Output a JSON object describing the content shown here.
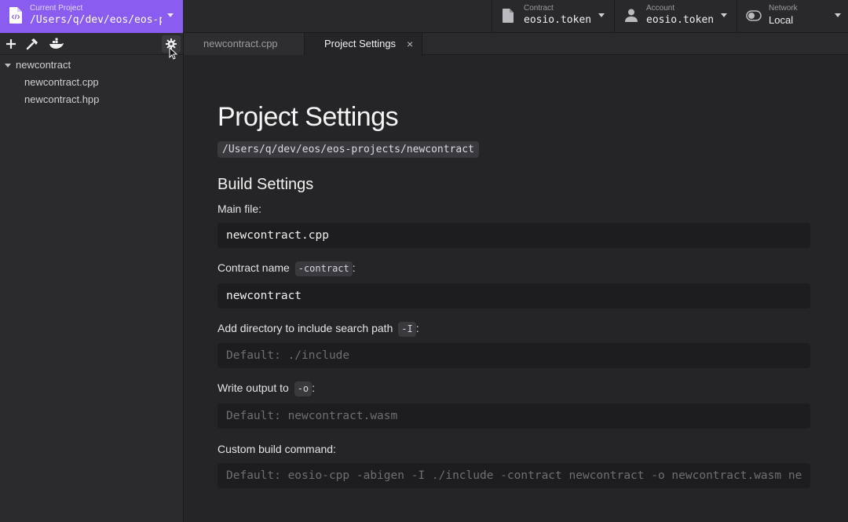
{
  "topbar": {
    "project": {
      "label": "Current Project",
      "value": "/Users/q/dev/eos/eos-p..."
    },
    "contract": {
      "label": "Contract",
      "value": "eosio.token"
    },
    "account": {
      "label": "Account",
      "value": "eosio.token"
    },
    "network": {
      "label": "Network",
      "value": "Local"
    }
  },
  "sidebar": {
    "tree": {
      "root": "newcontract",
      "children": [
        "newcontract.cpp",
        "newcontract.hpp"
      ]
    }
  },
  "tabs": [
    {
      "label": "newcontract.cpp"
    },
    {
      "label": "Project Settings",
      "close": "×"
    }
  ],
  "main": {
    "title": "Project Settings",
    "path": "/Users/q/dev/eos/eos-projects/newcontract",
    "section": "Build Settings",
    "fields": {
      "main_file": {
        "label": "Main file:",
        "value": "newcontract.cpp"
      },
      "contract_name": {
        "label": "Contract name",
        "flag": "-contract",
        "suffix": ":",
        "value": "newcontract"
      },
      "include_dir": {
        "label": "Add directory to include search path",
        "flag": "-I",
        "suffix": ":",
        "placeholder": "Default: ./include"
      },
      "output": {
        "label": "Write output to",
        "flag": "-o",
        "suffix": ":",
        "placeholder": "Default: newcontract.wasm"
      },
      "build_cmd": {
        "label": "Custom build command:",
        "placeholder": "Default: eosio-cpp -abigen -I ./include -contract newcontract -o newcontract.wasm ne"
      }
    }
  },
  "colors": {
    "accent": "#8a5cf0",
    "background": "#252527",
    "sidebar": "#2b2b2e",
    "input": "#1d1d1f"
  }
}
